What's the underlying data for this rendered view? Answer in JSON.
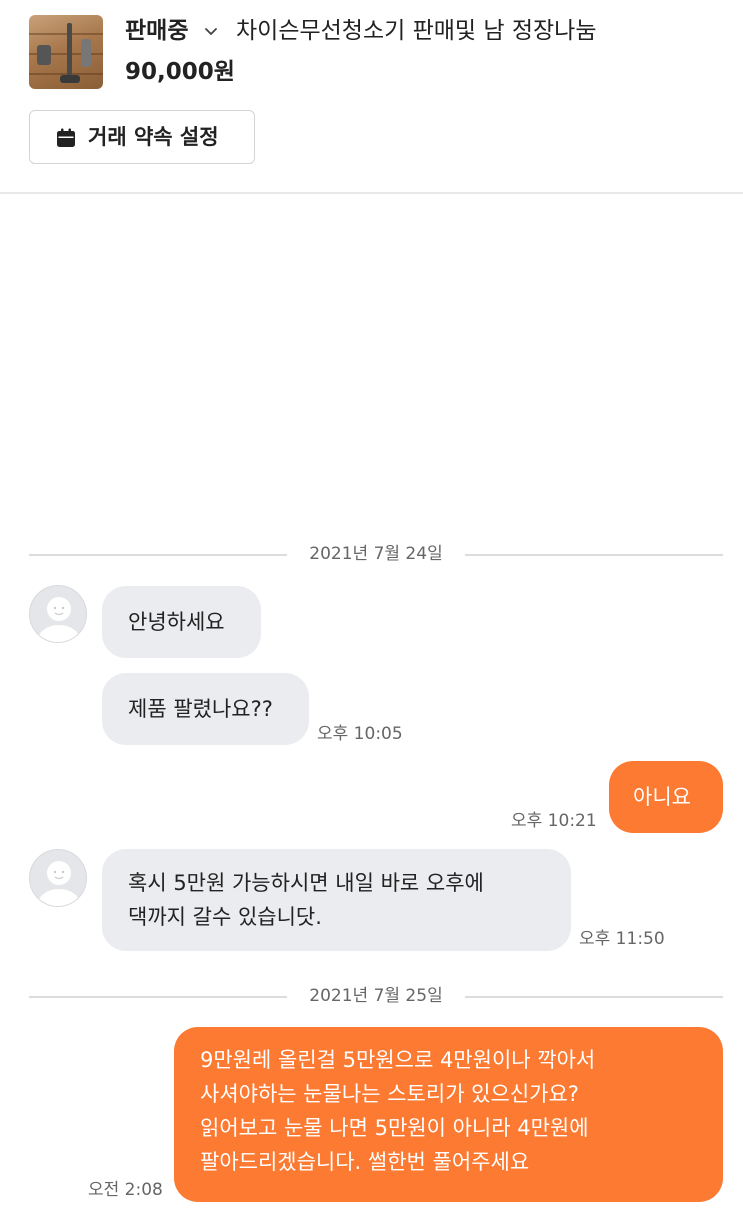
{
  "product": {
    "status": "판매중",
    "title": "차이슨무선청소기 판매및 남 정장나눔",
    "price": "90,000원",
    "status_dropdown_icon": "chevron-down-icon",
    "thumbnail_icon": "product-photo"
  },
  "promise_button": {
    "label": "거래 약속 설정",
    "icon": "calendar-icon"
  },
  "chat": {
    "date_separators": [
      "2021년 7월 24일",
      "2021년 7월 25일"
    ],
    "messages": [
      {
        "sender": "other",
        "lines": [
          "안녕하세요"
        ],
        "time": ""
      },
      {
        "sender": "other",
        "lines": [
          "제품 팔렸나요??"
        ],
        "time": "오후 10:05"
      },
      {
        "sender": "me",
        "lines": [
          "아니요"
        ],
        "time": "오후 10:21"
      },
      {
        "sender": "other",
        "lines": [
          "혹시 5만원 가능하시면 내일 바로 오후에",
          "댁까지 갈수 있습니닷."
        ],
        "time": "오후 11:50"
      },
      {
        "sender": "me",
        "lines": [
          "9만원레 올린걸 5만원으로 4만원이나 깍아서",
          "사셔야하는 눈물나는 스토리가 있으신가요?",
          "읽어보고 눈물 나면 5만원이 아니라 4만원에",
          "팔아드리겠습니다. 썰한번 풀어주세요"
        ],
        "time": "오전 2:08"
      }
    ]
  },
  "colors": {
    "my_bubble": "#fc7a32",
    "other_bubble": "#eaecef",
    "separator": "#dcdcdc"
  }
}
